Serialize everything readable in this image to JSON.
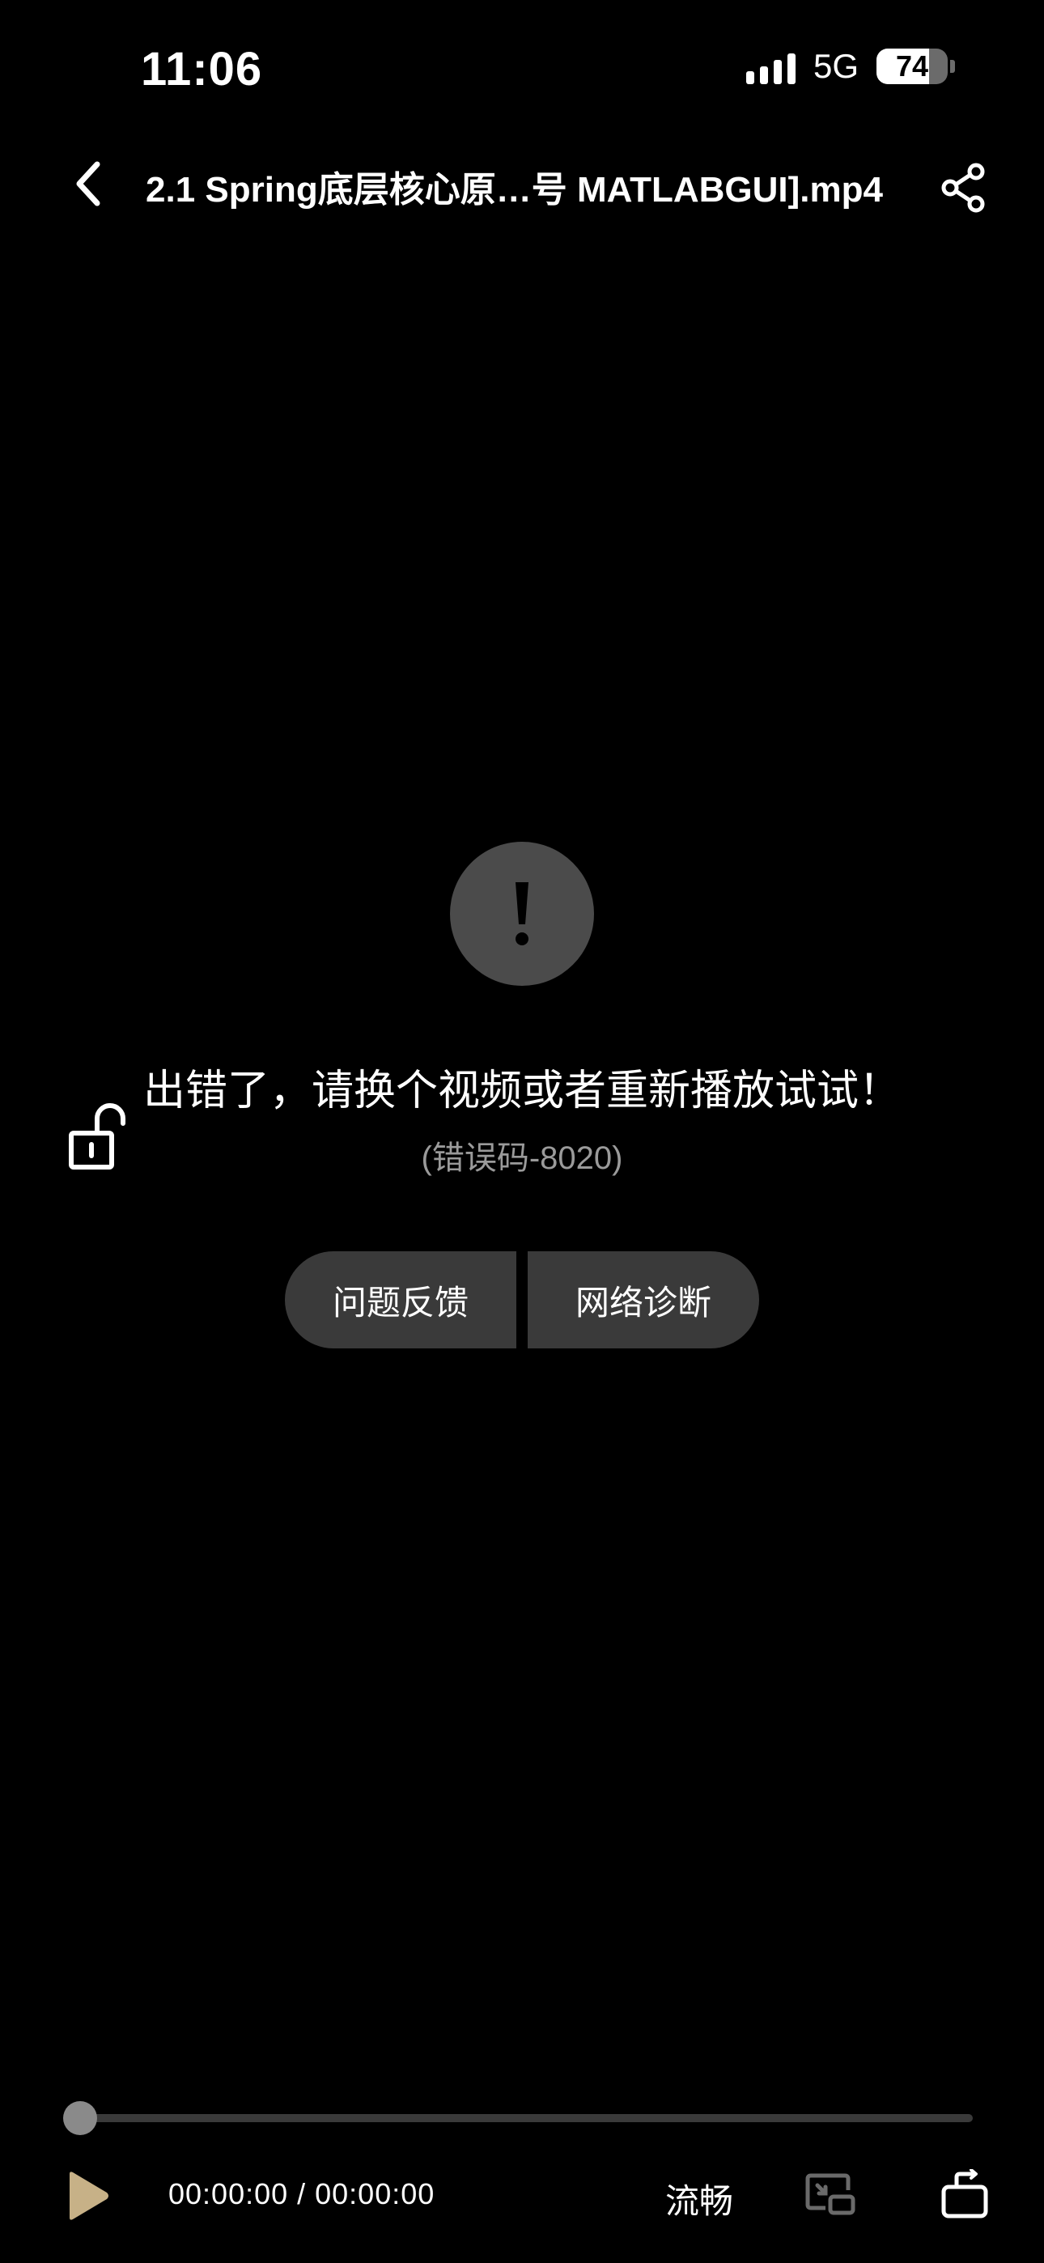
{
  "status_bar": {
    "time": "11:06",
    "network": "5G",
    "battery_level": "74",
    "battery_fraction": 0.74
  },
  "header": {
    "title": "2.1 Spring底层核心原…号 MATLABGUI].mp4",
    "back_icon": "chevron-left-icon",
    "share_icon": "share-icon"
  },
  "error": {
    "icon": "exclamation-icon",
    "message": "出错了，请换个视频或者重新播放试试！",
    "code": "(错误码-8020)",
    "buttons": {
      "feedback": "问题反馈",
      "network": "网络诊断"
    }
  },
  "controls": {
    "progress_fraction": 0,
    "time": "00:00:00 / 00:00:00",
    "quality": "流畅",
    "play_icon": "play-icon",
    "pip_icon": "picture-in-picture-icon",
    "rotate_icon": "rotate-screen-icon",
    "lock_icon": "unlock-icon",
    "play_color": "#c7b187"
  }
}
